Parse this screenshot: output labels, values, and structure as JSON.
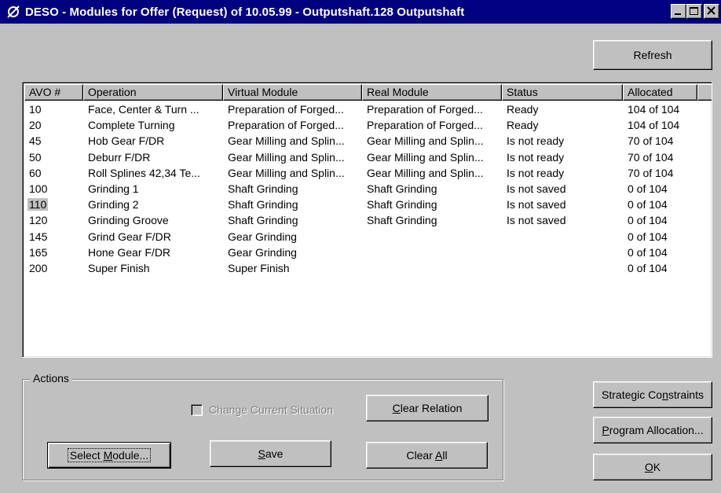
{
  "window": {
    "title": "DESO - Modules for Offer (Request) of 10.05.99 - Outputshaft.128 Outputshaft"
  },
  "toolbar": {
    "refresh_label": "Refresh"
  },
  "table": {
    "columns": [
      "AVO #",
      "Operation",
      "Virtual Module",
      "Real Module",
      "Status",
      "Allocated"
    ],
    "selected_row": 6,
    "rows": [
      {
        "avo": "10",
        "operation": "Face, Center & Turn ...",
        "virtual": "Preparation of Forged...",
        "real": "Preparation of Forged...",
        "status": "Ready",
        "allocated": "104 of 104"
      },
      {
        "avo": "20",
        "operation": "Complete Turning",
        "virtual": "Preparation of Forged...",
        "real": "Preparation of Forged...",
        "status": "Ready",
        "allocated": "104 of 104"
      },
      {
        "avo": "45",
        "operation": "Hob Gear F/DR",
        "virtual": "Gear Milling and Splin...",
        "real": "Gear Milling and Splin...",
        "status": "Is not ready",
        "allocated": "70 of 104"
      },
      {
        "avo": "50",
        "operation": "Deburr F/DR",
        "virtual": "Gear Milling and Splin...",
        "real": "Gear Milling and Splin...",
        "status": "Is not ready",
        "allocated": "70 of 104"
      },
      {
        "avo": "60",
        "operation": "Roll Splines 42,34 Te...",
        "virtual": "Gear Milling and Splin...",
        "real": "Gear Milling and Splin...",
        "status": "Is not ready",
        "allocated": "70 of 104"
      },
      {
        "avo": "100",
        "operation": "Grinding 1",
        "virtual": "Shaft Grinding",
        "real": "Shaft Grinding",
        "status": "Is not saved",
        "allocated": "0 of 104"
      },
      {
        "avo": "110",
        "operation": "Grinding 2",
        "virtual": "Shaft Grinding",
        "real": "Shaft Grinding",
        "status": "Is not saved",
        "allocated": "0 of 104"
      },
      {
        "avo": "120",
        "operation": "Grinding Groove",
        "virtual": "Shaft Grinding",
        "real": "Shaft Grinding",
        "status": "Is not saved",
        "allocated": "0 of 104"
      },
      {
        "avo": "145",
        "operation": "Grind Gear F/DR",
        "virtual": "Gear Grinding",
        "real": "",
        "status": "",
        "allocated": "0 of 104"
      },
      {
        "avo": "165",
        "operation": "Hone Gear F/DR",
        "virtual": "Gear Grinding",
        "real": "",
        "status": "",
        "allocated": "0 of 104"
      },
      {
        "avo": "200",
        "operation": "Super Finish",
        "virtual": "Super Finish",
        "real": "",
        "status": "",
        "allocated": "0 of 104"
      }
    ]
  },
  "actions": {
    "group_label": "Actions",
    "change_situation_label": "Change Current Situation",
    "change_situation_checked": false,
    "clear_relation_label": "Clear Relation",
    "select_module_label": "Select Module...",
    "save_label": "Save",
    "clear_all_label": "Clear All"
  },
  "side_buttons": {
    "strategic_constraints_label": "Strategic Constraints",
    "program_allocation_label": "Program Allocation...",
    "ok_label": "OK"
  }
}
